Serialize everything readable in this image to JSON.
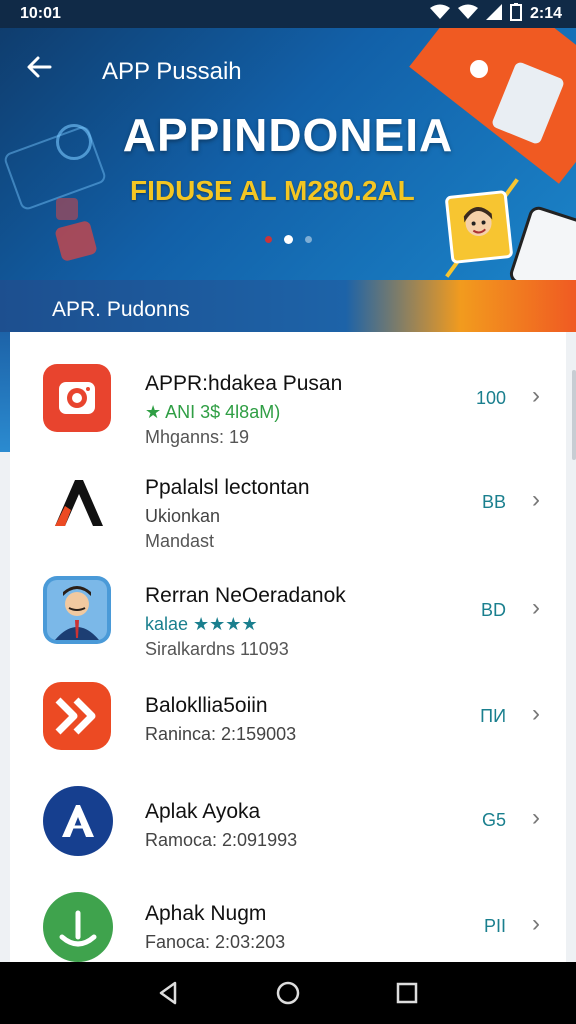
{
  "status_bar": {
    "time_left": "10:01",
    "time_right": "2:14",
    "icons": [
      "wifi-icon",
      "signal-icon",
      "battery-icon"
    ]
  },
  "banner": {
    "title": "APP Pussaih",
    "heading": "APPINDONEIA",
    "subheading": "FIDUSE AL M280.2AL",
    "carousel_total": 3,
    "carousel_active": 2
  },
  "section": {
    "label": "APR. Pudonns"
  },
  "apps": [
    {
      "title": "APPR:hdakea Pusan",
      "line2": "★ ANI 3$ 4l8aM)",
      "line3": "Mhganns: 19",
      "size": "100",
      "icon": "camera-icon",
      "icon_bg": "#e8442e"
    },
    {
      "title": "Ppalalsl lectontan",
      "line2": "Ukionkan",
      "line3": "Mandast",
      "size": "BB",
      "icon": "lambda-logo-icon",
      "icon_bg": "#ffffff"
    },
    {
      "title": "Rerran NeOeradanok",
      "line2": "kalae ★★★★",
      "line3": "Siralkardns 11093",
      "size": "BD",
      "icon": "person-avatar-icon",
      "icon_bg": "#4a9ad8"
    },
    {
      "title": "Balokllia5oiin",
      "line2": "Ranincа: 2:159003",
      "line3": "",
      "size": "ПИ",
      "icon": "chevrons-right-icon",
      "icon_bg": "#ec4a23"
    },
    {
      "title": "Aplak Ayoka",
      "line2": "Ramoca: 2:091993",
      "line3": "",
      "size": "G5",
      "icon": "letter-a-icon",
      "icon_bg": "#163f8f"
    },
    {
      "title": "Aphak Nugm",
      "line2": "Fanoca: 2:03:203",
      "line3": "",
      "size": "PII",
      "icon": "person-arc-icon",
      "icon_bg": "#3fa34d"
    }
  ],
  "nav": {
    "buttons": [
      "back-triangle-icon",
      "home-circle-icon",
      "recents-square-icon"
    ]
  }
}
